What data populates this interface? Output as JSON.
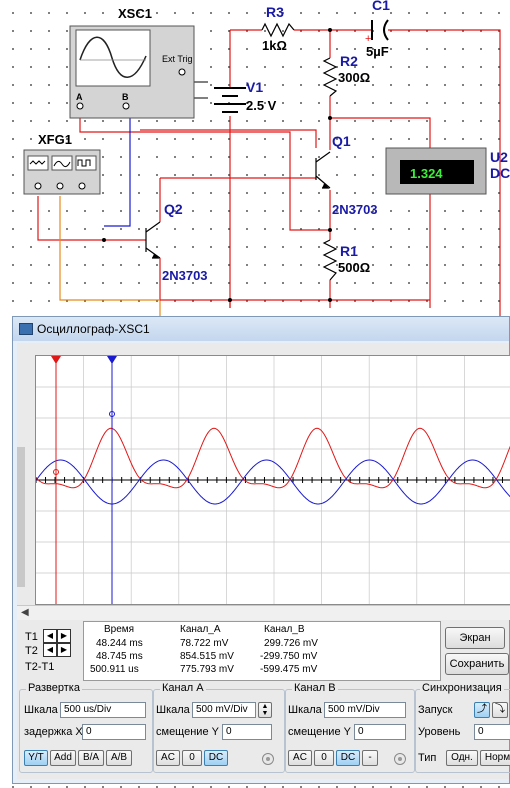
{
  "schematic": {
    "xsc1": {
      "name": "XSC1",
      "ext_trig": "Ext Trig",
      "channel_a": "A",
      "channel_b": "B"
    },
    "xfg1": {
      "name": "XFG1"
    },
    "r3": {
      "name": "R3",
      "value": "1kΩ"
    },
    "c1": {
      "name": "C1",
      "value": "5µF"
    },
    "r2": {
      "name": "R2",
      "value": "300Ω"
    },
    "v1": {
      "name": "V1",
      "value": "2.5 V"
    },
    "q1": {
      "name": "Q1",
      "model": "2N3703"
    },
    "q2": {
      "name": "Q2",
      "model": "2N3703"
    },
    "r1": {
      "name": "R1",
      "value": "500Ω"
    },
    "u2": {
      "name": "U2",
      "mode": "DC",
      "reading": "1.324"
    }
  },
  "scope_window": {
    "title": "Осциллограф-XSC1",
    "readout": {
      "headers": {
        "time": "Время",
        "channel_a": "Канал_A",
        "channel_b": "Канал_B"
      },
      "rows": [
        {
          "label": "T1",
          "time": "48.244 ms",
          "a": "78.722 mV",
          "b": "299.726 mV"
        },
        {
          "label": "T2",
          "time": "48.745 ms",
          "a": "854.515 mV",
          "b": "-299.750 mV"
        },
        {
          "label": "T2-T1",
          "time": "500.911 us",
          "a": "775.793 mV",
          "b": "-599.475 mV"
        }
      ]
    },
    "buttons": {
      "screen": "Экран",
      "save": "Сохранить"
    },
    "timebase": {
      "title": "Развертка",
      "scale_label": "Шкала",
      "scale_value": "500 us/Div",
      "delay_label": "задержка X",
      "delay_value": "0",
      "modes": [
        "Y/T",
        "Add",
        "B/A",
        "A/B"
      ]
    },
    "channel_a": {
      "title": "Канал A",
      "scale_label": "Шкала",
      "scale_value": "500 mV/Div",
      "offset_label": "смещение Y",
      "offset_value": "0",
      "coupling": [
        "AC",
        "0",
        "DC"
      ]
    },
    "channel_b": {
      "title": "Канал B",
      "scale_label": "Шкала",
      "scale_value": "500 mV/Div",
      "offset_label": "смещение Y",
      "offset_value": "0",
      "coupling": [
        "AC",
        "0",
        "DC",
        "-"
      ]
    },
    "trigger": {
      "title": "Синхронизация",
      "edge_label": "Запуск",
      "level_label": "Уровень",
      "level_value": "0",
      "type_label": "Тип",
      "types": [
        "Одн.",
        "Норм"
      ]
    }
  },
  "colors": {
    "channel_a": "#e01818",
    "channel_b": "#1a1ad0",
    "wire_red": "#e01818",
    "wire_blue": "#1a1ad0",
    "wire_orange": "#e88a1a"
  }
}
